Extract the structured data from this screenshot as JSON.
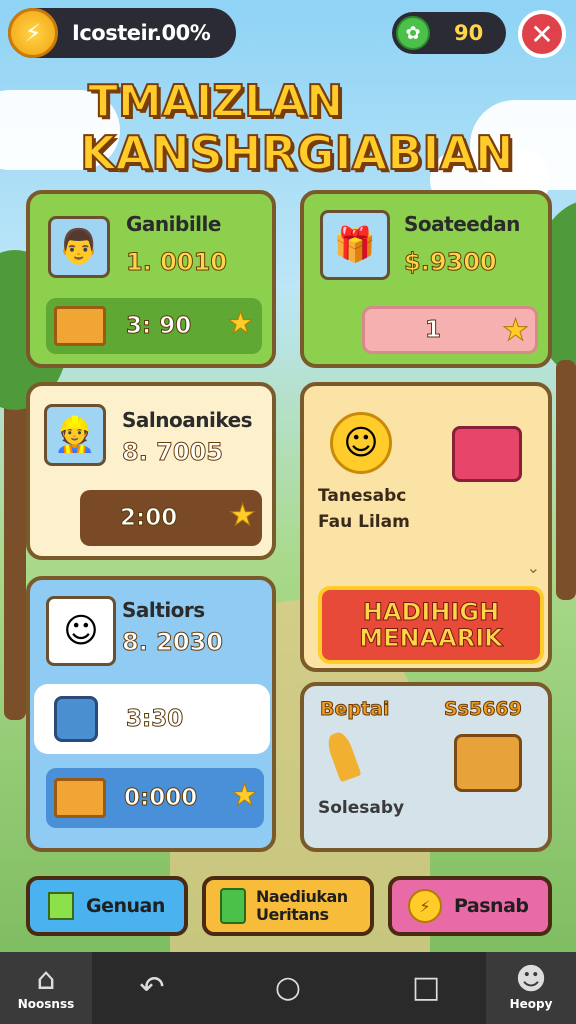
{
  "topbar": {
    "label": "Icosteir.00%",
    "coin_icon": "lightning-coin-icon",
    "gem_value": "90",
    "gem_icon": "gem-icon",
    "close_icon": "close-icon"
  },
  "title": {
    "line1": "TMAIZLAN",
    "line2": "KANSHRGIABIAN"
  },
  "cards": {
    "farmer": {
      "name": "Ganibille",
      "price": "1. 0010",
      "pill_value": "3: 90"
    },
    "gift": {
      "name": "Soateedan",
      "price": "$.9300",
      "pill_value": "1"
    },
    "worker": {
      "name": "Salnoanikes",
      "price": "8. 7005",
      "pill_value": "2:00"
    },
    "promo": {
      "line1": "Tanesabc",
      "line2": "Fau Lilam",
      "cta_line1": "HADIHIGH",
      "cta_line2": "MENAARIK"
    },
    "blue": {
      "name": "Saltiors",
      "price": "8. 2030",
      "row1_value": "3:30",
      "row2_value": "0:000"
    },
    "bottom": {
      "label_left": "Beptai",
      "label_right": "Ss5669",
      "caption": "Solesaby"
    }
  },
  "actions": {
    "left": "Genuan",
    "middle_line1": "Naediukan",
    "middle_line2": "Ueritans",
    "right": "Pasnab"
  },
  "navbar": {
    "home_label": "Noosnss",
    "right_label": "Heopy"
  },
  "colors": {
    "green_card": "#8cd04e",
    "blue_card": "#8fcbf3",
    "cta_red": "#e84a3a",
    "gold": "#ffd54a"
  }
}
